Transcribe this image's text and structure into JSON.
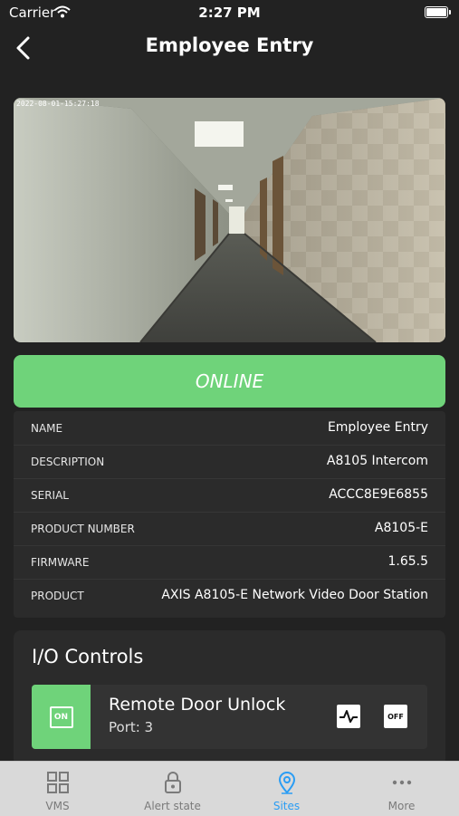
{
  "status_bar": {
    "carrier": "Carrier",
    "time": "2:27 PM"
  },
  "nav": {
    "title": "Employee Entry"
  },
  "camera": {
    "timestamp": "2022-08-01-15:27:18"
  },
  "status": {
    "label": "ONLINE",
    "color": "#6fd37a"
  },
  "info": {
    "rows": [
      {
        "key": "NAME",
        "value": "Employee Entry"
      },
      {
        "key": "DESCRIPTION",
        "value": "A8105 Intercom"
      },
      {
        "key": "SERIAL",
        "value": "ACCC8E9E6855"
      },
      {
        "key": "PRODUCT NUMBER",
        "value": "A8105-E"
      },
      {
        "key": "FIRMWARE",
        "value": "1.65.5"
      },
      {
        "key": "PRODUCT",
        "value": "AXIS A8105-E Network Video Door Station"
      }
    ]
  },
  "io": {
    "title": "I/O Controls",
    "item": {
      "on_label": "ON",
      "name": "Remote Door Unlock",
      "port": "Port: 3",
      "off_label": "OFF",
      "pulse_icon": "pulse-icon"
    }
  },
  "tabs": [
    {
      "label": "VMS",
      "icon": "grid-icon",
      "active": false
    },
    {
      "label": "Alert state",
      "icon": "lock-icon",
      "active": false
    },
    {
      "label": "Sites",
      "icon": "map-pin-icon",
      "active": true
    },
    {
      "label": "More",
      "icon": "more-dots-icon",
      "active": false
    }
  ],
  "colors": {
    "accent": "#2a9df4",
    "online": "#6fd37a",
    "background": "#222222"
  }
}
